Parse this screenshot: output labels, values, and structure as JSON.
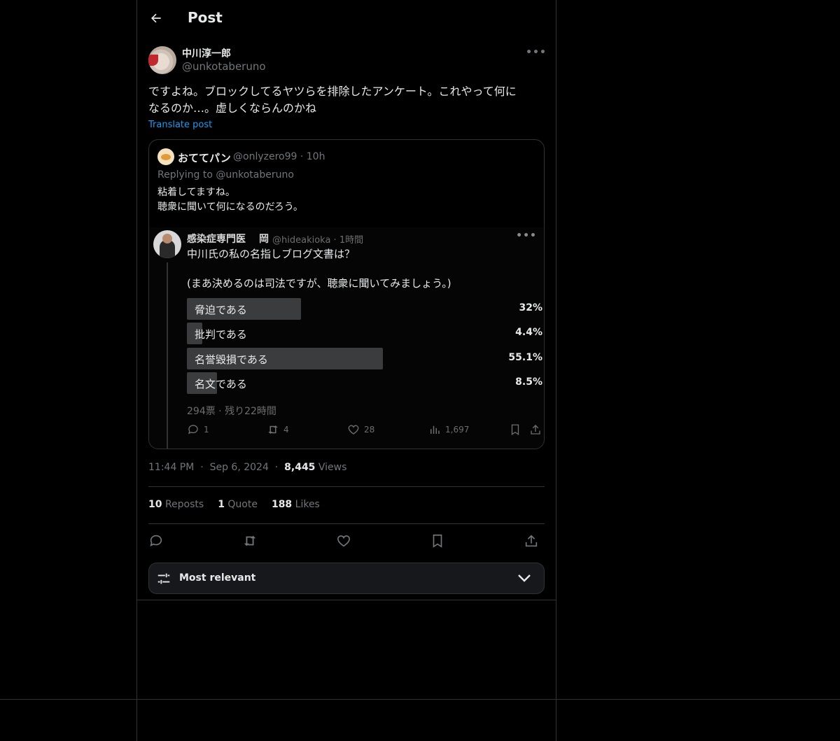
{
  "header": {
    "title": "Post"
  },
  "post": {
    "author_name": "中川淳一郎",
    "author_handle": "@unkotaberuno",
    "text_line1": "ですよね。ブロックしてるヤツらを排除したアンケート。これやって何に",
    "text_line2": "なるのか…。虚しくならんのかね",
    "translate_label": "Translate post"
  },
  "quote": {
    "name": "おててパン",
    "meta": "@onlyzero99 · 10h",
    "replying": "Replying to @unkotaberuno",
    "text_line1": "粘着してますね。",
    "text_line2": "聴衆に聞いて何になるのだろう。",
    "screenshot": {
      "name": "感染症専門医",
      "name2": "岡",
      "meta": "@hideakioka · 1時間",
      "text_line1": "中川氏の私の名指しブログ文書は？",
      "text_line2": "(まあ決めるのは司法ですが、聴衆に聞いてみましょう。)",
      "poll": [
        {
          "label": "脅迫である",
          "pct": "32%",
          "value": 32
        },
        {
          "label": "批判である",
          "pct": "4.4%",
          "value": 4.4
        },
        {
          "label": "名誉毀損である",
          "pct": "55.1%",
          "value": 55.1
        },
        {
          "label": "名文である",
          "pct": "8.5%",
          "value": 8.5
        }
      ],
      "poll_footer": "294票 · 残り22時間",
      "counts": {
        "replies": "1",
        "reposts": "4",
        "likes": "28",
        "views": "1,697"
      }
    }
  },
  "meta": {
    "time": "11:44 PM",
    "date": "Sep 6, 2024",
    "views_count": "8,445",
    "views_label": "Views"
  },
  "stats": {
    "reposts_count": "10",
    "reposts_label": "Reposts",
    "quotes_count": "1",
    "quotes_label": "Quote",
    "likes_count": "188",
    "likes_label": "Likes"
  },
  "sort": {
    "label": "Most relevant"
  },
  "colors": {
    "background": "#000000",
    "border": "#2f3336",
    "accent": "#1d9bf0",
    "muted": "#71767b"
  },
  "icons": [
    "back-arrow-icon",
    "more-icon",
    "reply-icon",
    "repost-icon",
    "like-icon",
    "bookmark-icon",
    "share-icon",
    "views-icon",
    "sliders-icon",
    "chevron-down-icon"
  ]
}
